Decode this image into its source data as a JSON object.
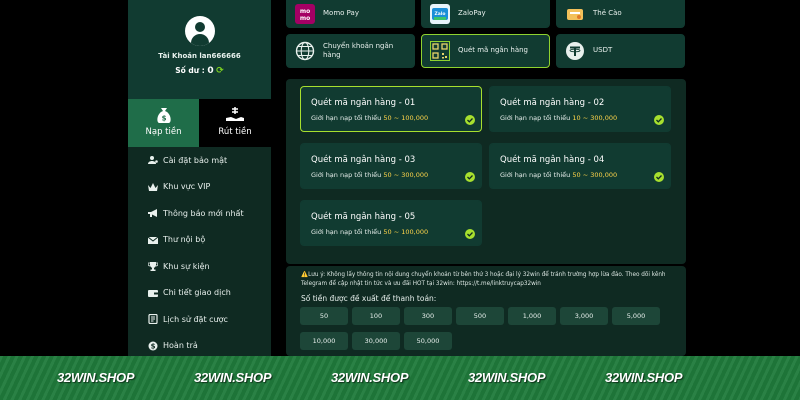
{
  "sidebar": {
    "username": "Tài Khoản lan666666",
    "balance_label": "Số dư : ",
    "balance_value": "0",
    "tabs": [
      {
        "label": "Nạp tiền",
        "icon": "money-bag-icon",
        "active": true
      },
      {
        "label": "Rút tiền",
        "icon": "hand-money-icon",
        "active": false
      }
    ],
    "menu": [
      {
        "label": "Cài đặt bảo mật",
        "icon": "user-gear-icon"
      },
      {
        "label": "Khu vực VIP",
        "icon": "crown-icon"
      },
      {
        "label": "Thông báo mới nhất",
        "icon": "megaphone-icon"
      },
      {
        "label": "Thư nội bộ",
        "icon": "envelope-icon"
      },
      {
        "label": "Khu sự kiện",
        "icon": "trophy-icon"
      },
      {
        "label": "Chi tiết giao dịch",
        "icon": "wallet-icon"
      },
      {
        "label": "Lịch sử đặt cược",
        "icon": "history-icon"
      },
      {
        "label": "Hoàn trả",
        "icon": "refund-icon"
      }
    ]
  },
  "methods": [
    {
      "label": "Momo Pay",
      "icon": "momo-icon"
    },
    {
      "label": "ZaloPay",
      "icon": "zalopay-icon"
    },
    {
      "label": "Thẻ Cào",
      "icon": "scratch-card-icon"
    },
    {
      "label": "Chuyển khoản ngân hàng",
      "icon": "globe-icon"
    },
    {
      "label": "Quét mã ngân hàng",
      "icon": "qr-code-icon",
      "active": true
    },
    {
      "label": "USDT",
      "icon": "tether-icon"
    }
  ],
  "banks": [
    {
      "name": "Quét mã ngân hàng - 01",
      "limit_label": "Giới hạn nạp tối thiểu",
      "min": "50",
      "sep": "~",
      "max": "100,000",
      "active": true
    },
    {
      "name": "Quét mã ngân hàng - 02",
      "limit_label": "Giới hạn nạp tối thiểu",
      "min": "10",
      "sep": "~",
      "max": "300,000"
    },
    {
      "name": "Quét mã ngân hàng - 03",
      "limit_label": "Giới hạn nạp tối thiểu",
      "min": "50",
      "sep": "~",
      "max": "300,000"
    },
    {
      "name": "Quét mã ngân hàng - 04",
      "limit_label": "Giới hạn nạp tối thiểu",
      "min": "50",
      "sep": "~",
      "max": "300,000"
    },
    {
      "name": "Quét mã ngân hàng - 05",
      "limit_label": "Giới hạn nạp tối thiểu",
      "min": "50",
      "sep": "~",
      "max": "100,000"
    }
  ],
  "notice": {
    "warn": "⚠️",
    "text": "Lưu ý: Không lấy thông tin nội dung chuyển khoản từ bên thứ 3 hoặc đại lý 32win để tránh trường hợp lừa đảo. Theo dõi kênh Telegram để cập nhật tin tức và ưu đãi HOT tại 32win: https://t.me/linktruycap32win"
  },
  "amounts": {
    "title": "Số tiền được đề xuất để thanh toán:",
    "values": [
      "50",
      "100",
      "300",
      "500",
      "1,000",
      "3,000",
      "5,000",
      "10,000",
      "30,000",
      "50,000"
    ]
  },
  "footer": {
    "watermark": "32WIN.SHOP",
    "repeat": 5
  },
  "colors": {
    "accent": "#8fd22f",
    "check": "#a7e02e",
    "limit_number": "#ffd54a",
    "panel": "#0f2a22",
    "card": "#113b31",
    "tab_active": "#1f6d49",
    "footer": "#1f7a3b"
  }
}
